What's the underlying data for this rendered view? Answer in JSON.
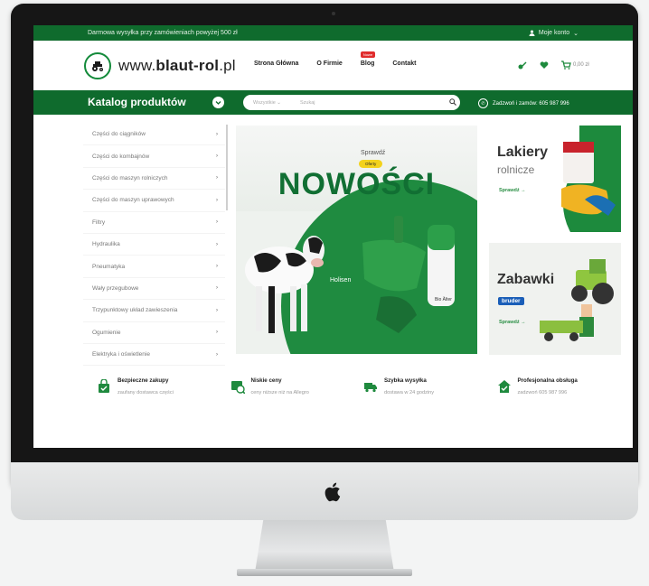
{
  "topbar": {
    "shipping_note": "Darmowa wysyłka przy zamówieniach powyżej 500 zł",
    "account_label": "Moje konto"
  },
  "header": {
    "logo_prefix": "www.",
    "logo_bold": "blaut-rol",
    "logo_suffix": ".pl",
    "nav": [
      "Strona Główna",
      "O Firmie",
      "Blog",
      "Contakt"
    ],
    "blog_badge": "Nowe",
    "cart_total": "0,00 zł"
  },
  "catalogbar": {
    "title": "Katalog produktów",
    "search_select": "Wszystkie",
    "search_placeholder": "Szukaj",
    "phone_text": "Zadzwoń i zamów: 605 987 996"
  },
  "sidebar": {
    "items": [
      "Części do ciągników",
      "Części do kombajnów",
      "Części do maszyn rolniczych",
      "Części do maszyn uprawowych",
      "Filtry",
      "Hydraulika",
      "Pneumatyka",
      "Wały przegubowe",
      "Trzypunktowy układ zawieszenia",
      "Ogumienie",
      "Elektryka i oświetlenie"
    ]
  },
  "hero": {
    "subtitle": "Sprawdź",
    "badge": "Oferty",
    "title": "NOWOŚCI",
    "product_label": "Holisen"
  },
  "promos": [
    {
      "title": "Lakiery",
      "subtitle": "rolnicze",
      "cta": "Sprawdź →"
    },
    {
      "title": "Zabawki",
      "brand": "bruder",
      "cta": "Sprawdź →"
    }
  ],
  "features": [
    {
      "title": "Bezpieczne zakupy",
      "subtitle": "zaufany dostawca części"
    },
    {
      "title": "Niskie ceny",
      "subtitle": "ceny niższe niż na Allegro"
    },
    {
      "title": "Szybka wysyłka",
      "subtitle": "dostawa w 24 godziny"
    },
    {
      "title": "Profesjonalna obsługa",
      "subtitle": "zadzwoń 605 987 996"
    }
  ],
  "colors": {
    "brand_green": "#0f6b2d",
    "accent_yellow": "#f3d21c",
    "badge_red": "#e02c2c"
  }
}
